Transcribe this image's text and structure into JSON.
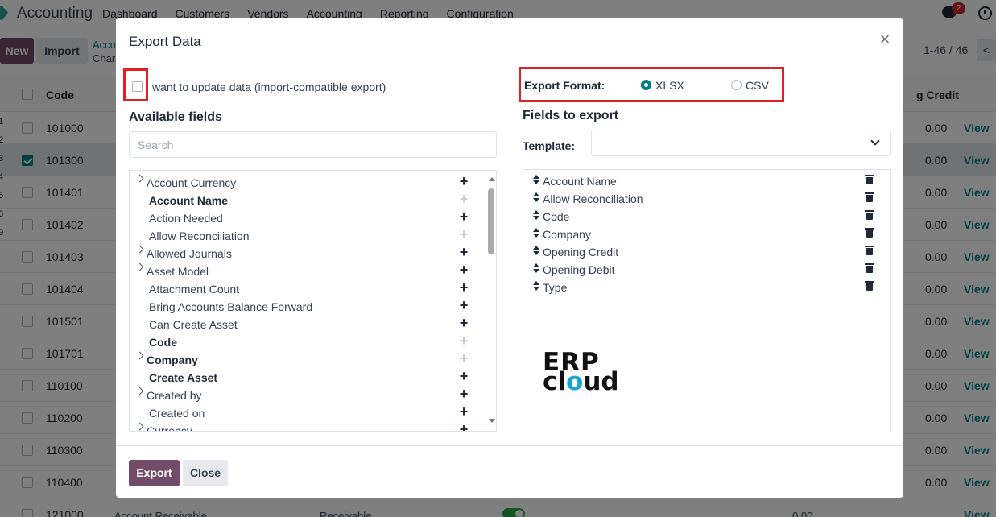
{
  "app": {
    "name": "Accounting",
    "menu": [
      "Dashboard",
      "Customers",
      "Vendors",
      "Accounting",
      "Reporting",
      "Configuration"
    ],
    "chat_badge": "2"
  },
  "control": {
    "new_label": "New",
    "import_label": "Import",
    "breadcrumb_top": "Acco",
    "breadcrumb_bottom": "Char",
    "pager": "1-46 / 46",
    "pager_prev": "<"
  },
  "list": {
    "header_code": "Code",
    "header_credit": "g Credit",
    "left_digits": [
      "1",
      "2",
      "3",
      "4",
      "5",
      "6",
      "9"
    ],
    "rows": [
      {
        "code": "101000",
        "credit": "0.00",
        "view": "View",
        "selected": false
      },
      {
        "code": "101300",
        "credit": "0.00",
        "view": "View",
        "selected": true
      },
      {
        "code": "101401",
        "credit": "0.00",
        "view": "View",
        "selected": false
      },
      {
        "code": "101402",
        "credit": "0.00",
        "view": "View",
        "selected": false
      },
      {
        "code": "101403",
        "credit": "0.00",
        "view": "View",
        "selected": false
      },
      {
        "code": "101404",
        "credit": "0.00",
        "view": "View",
        "selected": false
      },
      {
        "code": "101501",
        "credit": "0.00",
        "view": "View",
        "selected": false
      },
      {
        "code": "101701",
        "credit": "0.00",
        "view": "View",
        "selected": false
      },
      {
        "code": "110100",
        "credit": "0.00",
        "view": "View",
        "selected": false
      },
      {
        "code": "110200",
        "credit": "0.00",
        "view": "View",
        "selected": false
      },
      {
        "code": "110300",
        "credit": "0.00",
        "view": "View",
        "selected": false
      },
      {
        "code": "110400",
        "credit": "0.00",
        "view": "View",
        "selected": false
      }
    ],
    "last_row": {
      "code": "121000",
      "name": "Account Receivable",
      "type": "Receivable",
      "credit": "0.00",
      "view": "View"
    }
  },
  "modal": {
    "title": "Export Data",
    "close_icon": "×",
    "import_compat_label": "want to update data (import-compatible export)",
    "export_format_label": "Export Format:",
    "format_options": [
      {
        "label": "XLSX",
        "selected": true
      },
      {
        "label": "CSV",
        "selected": false
      }
    ],
    "available_title": "Available fields",
    "search_placeholder": "Search",
    "available_fields": [
      {
        "label": "Account Currency",
        "expandable": true,
        "bold": false,
        "added": false
      },
      {
        "label": "Account Name",
        "expandable": false,
        "bold": true,
        "added": true
      },
      {
        "label": "Action Needed",
        "expandable": false,
        "bold": false,
        "added": false
      },
      {
        "label": "Allow Reconciliation",
        "expandable": false,
        "bold": false,
        "added": true
      },
      {
        "label": "Allowed Journals",
        "expandable": true,
        "bold": false,
        "added": false
      },
      {
        "label": "Asset Model",
        "expandable": true,
        "bold": false,
        "added": false
      },
      {
        "label": "Attachment Count",
        "expandable": false,
        "bold": false,
        "added": false
      },
      {
        "label": "Bring Accounts Balance Forward",
        "expandable": false,
        "bold": false,
        "added": false
      },
      {
        "label": "Can Create Asset",
        "expandable": false,
        "bold": false,
        "added": false
      },
      {
        "label": "Code",
        "expandable": false,
        "bold": true,
        "added": true
      },
      {
        "label": "Company",
        "expandable": true,
        "bold": true,
        "added": true
      },
      {
        "label": "Create Asset",
        "expandable": false,
        "bold": true,
        "added": false
      },
      {
        "label": "Created by",
        "expandable": true,
        "bold": false,
        "added": false
      },
      {
        "label": "Created on",
        "expandable": false,
        "bold": false,
        "added": false
      },
      {
        "label": "Currency",
        "expandable": true,
        "bold": false,
        "added": false
      }
    ],
    "export_title": "Fields to export",
    "template_label": "Template:",
    "export_fields": [
      "Account Name",
      "Allow Reconciliation",
      "Code",
      "Company",
      "Opening Credit",
      "Opening Debit",
      "Type"
    ],
    "logo_line1": "ERP",
    "logo_line2_a": "cl",
    "logo_line2_o": "o",
    "logo_line2_b": "ud",
    "export_button": "Export",
    "close_button": "Close"
  }
}
